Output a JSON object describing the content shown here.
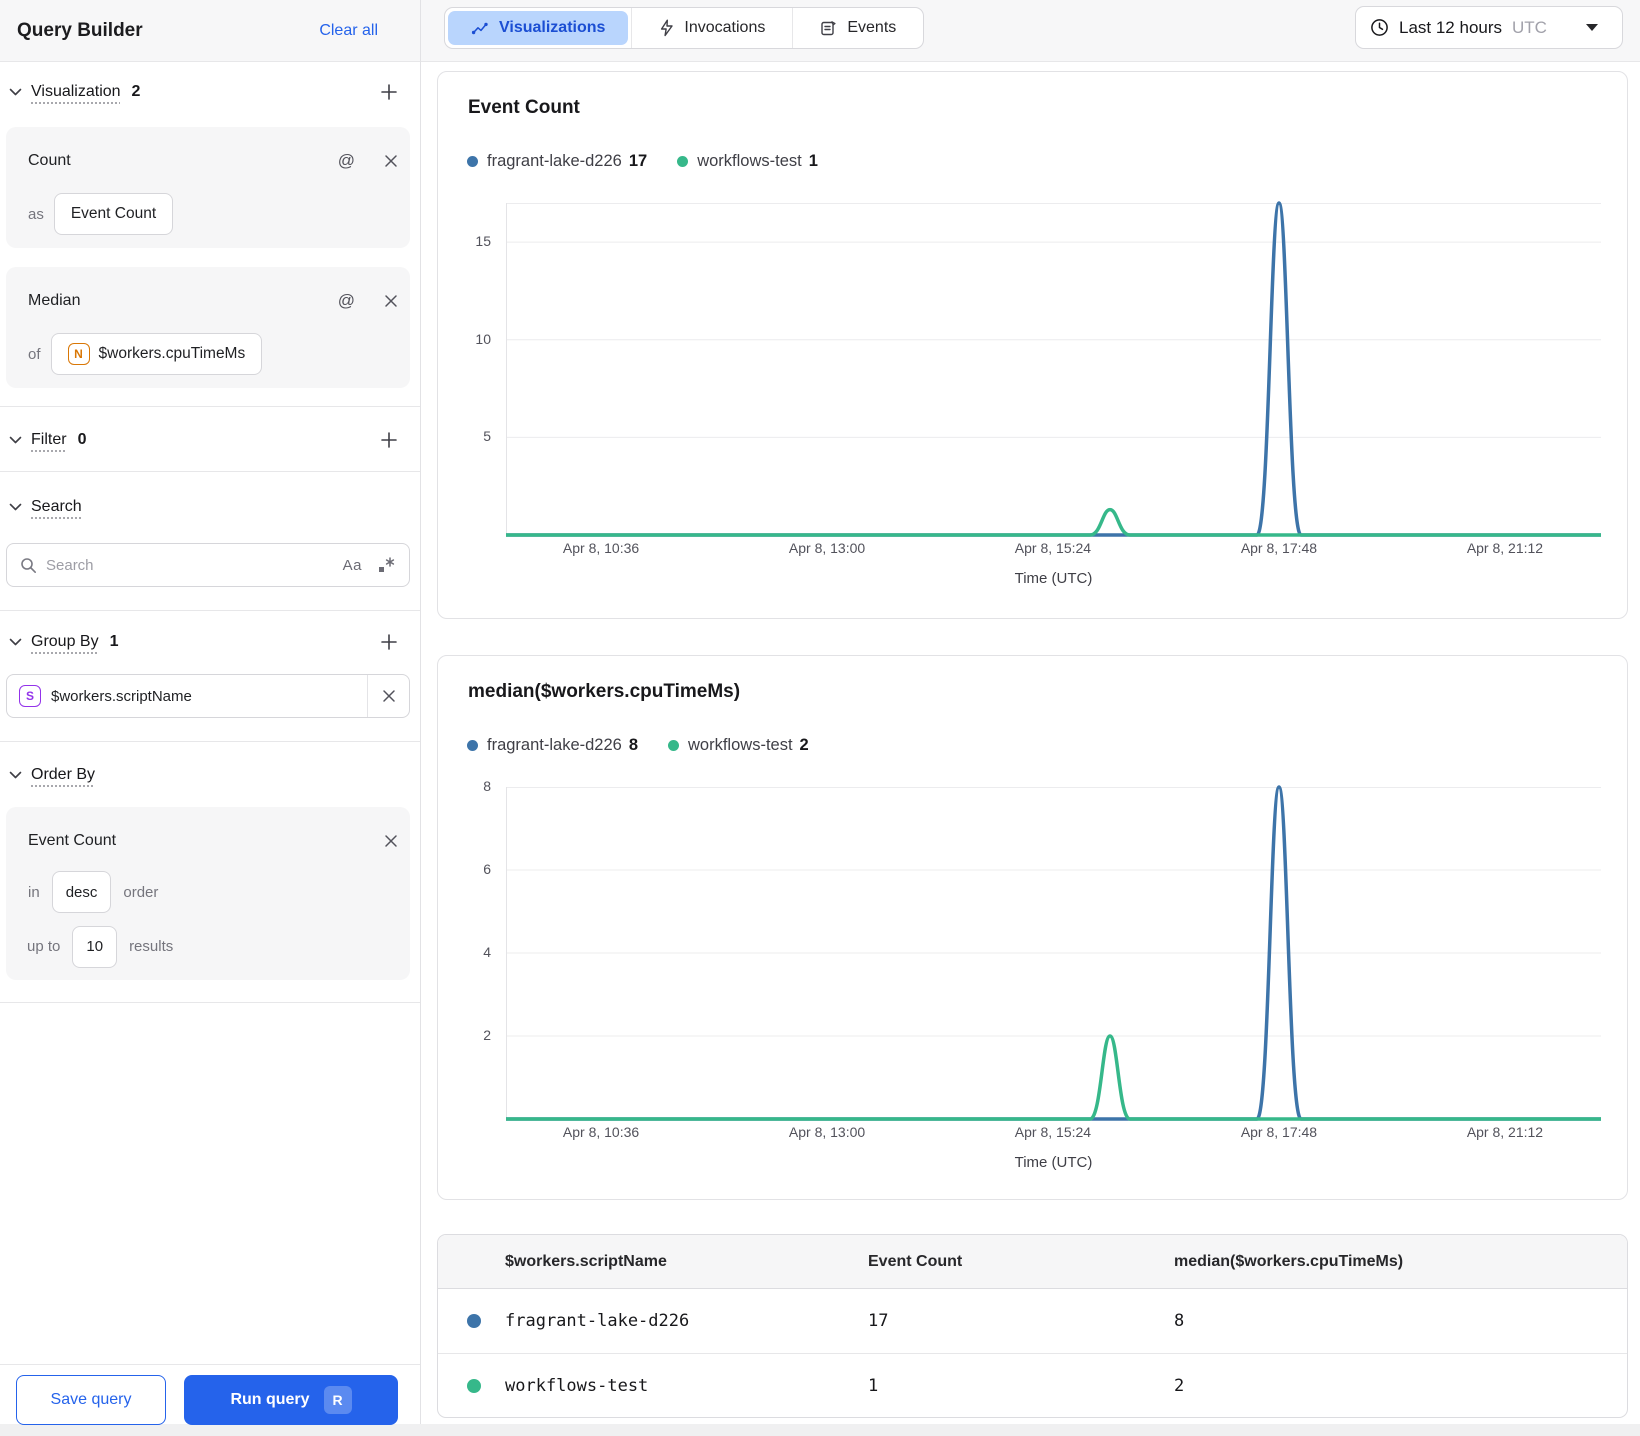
{
  "sidebar": {
    "title": "Query Builder",
    "clear_all": "Clear all",
    "visualization": {
      "label": "Visualization",
      "count": "2",
      "cards": [
        {
          "title": "Count",
          "prefix": "as",
          "value": "Event Count"
        },
        {
          "title": "Median",
          "prefix": "of",
          "value": "$workers.cpuTimeMs",
          "value_icon": "N"
        }
      ]
    },
    "filter": {
      "label": "Filter",
      "count": "0"
    },
    "search": {
      "label": "Search",
      "placeholder": "Search",
      "match_case_icon": "Aa"
    },
    "group_by": {
      "label": "Group By",
      "count": "1",
      "field": {
        "icon": "S",
        "value": "$workers.scriptName"
      }
    },
    "order_by": {
      "label": "Order By",
      "card": {
        "title": "Event Count",
        "in_label": "in",
        "direction": "desc",
        "order_label": "order",
        "up_to_label": "up to",
        "limit": "10",
        "results_label": "results"
      }
    },
    "footer": {
      "save": "Save query",
      "run": "Run query",
      "run_shortcut": "R"
    }
  },
  "tabs": [
    {
      "label": "Visualizations",
      "icon": "chart-line-icon",
      "active": true
    },
    {
      "label": "Invocations",
      "icon": "lightning-icon",
      "active": false
    },
    {
      "label": "Events",
      "icon": "events-icon",
      "active": false
    }
  ],
  "time_range": {
    "label": "Last 12 hours",
    "timezone": "UTC"
  },
  "colors": {
    "blue": "#3d74a9",
    "green": "#36b88a",
    "accent": "#2563eb",
    "tab_active_bg": "#b9d5fd",
    "tab_active_text": "#1b4ed3"
  },
  "chart_data": [
    {
      "type": "line",
      "title": "Event Count",
      "xlabel": "Time (UTC)",
      "ylim": [
        0,
        17
      ],
      "y_ticks": [
        5,
        10,
        15
      ],
      "x_ticks": [
        {
          "label": "Apr 8, 10:36",
          "frac": 0.0868
        },
        {
          "label": "Apr 8, 13:00",
          "frac": 0.2932
        },
        {
          "label": "Apr 8, 15:24",
          "frac": 0.4995
        },
        {
          "label": "Apr 8, 17:48",
          "frac": 0.7059
        },
        {
          "label": "Apr 8, 21:12",
          "frac": 0.9123
        }
      ],
      "legend": [
        {
          "name": "fragrant-lake-d226",
          "value": "17",
          "color": "blue"
        },
        {
          "name": "workflows-test",
          "value": "1",
          "color": "green"
        }
      ],
      "series": [
        {
          "name": "fragrant-lake-d226",
          "color": "blue",
          "spikes": [
            {
              "frac": 0.7059,
              "value": 17,
              "half_frac": 0.0201
            }
          ]
        },
        {
          "name": "workflows-test",
          "color": "green",
          "spikes": [
            {
              "frac": 0.5516,
              "value": 1.3,
              "half_frac": 0.0183
            }
          ]
        }
      ]
    },
    {
      "type": "line",
      "title": "median($workers.cpuTimeMs)",
      "xlabel": "Time (UTC)",
      "ylim": [
        0,
        8
      ],
      "y_ticks": [
        2,
        4,
        6,
        8
      ],
      "x_ticks": [
        {
          "label": "Apr 8, 10:36",
          "frac": 0.0868
        },
        {
          "label": "Apr 8, 13:00",
          "frac": 0.2932
        },
        {
          "label": "Apr 8, 15:24",
          "frac": 0.4995
        },
        {
          "label": "Apr 8, 17:48",
          "frac": 0.7059
        },
        {
          "label": "Apr 8, 21:12",
          "frac": 0.9123
        }
      ],
      "legend": [
        {
          "name": "fragrant-lake-d226",
          "value": "8",
          "color": "blue"
        },
        {
          "name": "workflows-test",
          "value": "2",
          "color": "green"
        }
      ],
      "series": [
        {
          "name": "fragrant-lake-d226",
          "color": "blue",
          "spikes": [
            {
              "frac": 0.7059,
              "value": 8,
              "half_frac": 0.0201
            }
          ]
        },
        {
          "name": "workflows-test",
          "color": "green",
          "spikes": [
            {
              "frac": 0.5516,
              "value": 2,
              "half_frac": 0.0183
            }
          ]
        }
      ]
    }
  ],
  "table": {
    "columns": [
      "$workers.scriptName",
      "Event Count",
      "median($workers.cpuTimeMs)"
    ],
    "rows": [
      {
        "dot": "blue",
        "name": "fragrant-lake-d226",
        "event_count": "17",
        "median": "8"
      },
      {
        "dot": "green",
        "name": "workflows-test",
        "event_count": "1",
        "median": "2"
      }
    ]
  }
}
